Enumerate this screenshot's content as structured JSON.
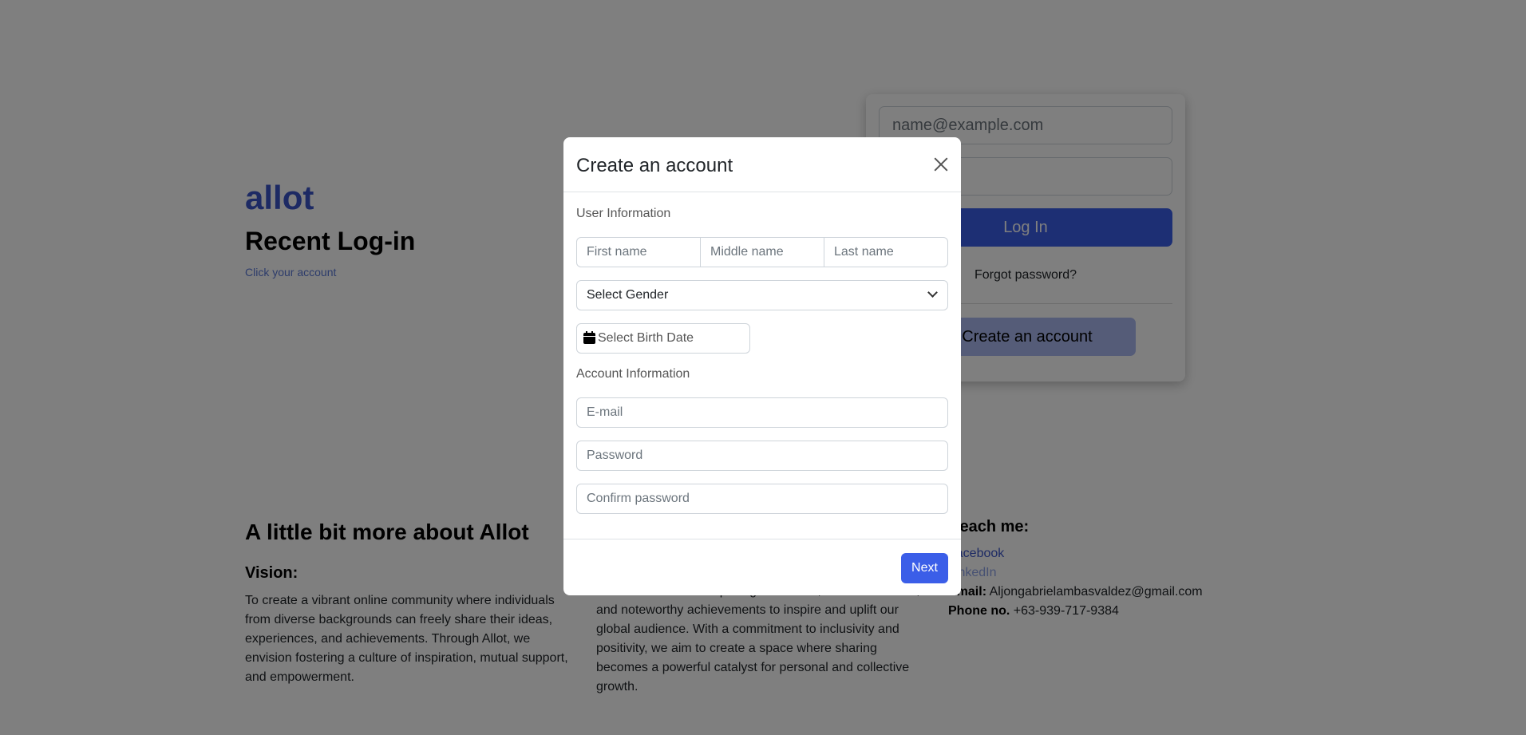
{
  "background": {
    "brand": "allot",
    "recent_login": {
      "title": "Recent Log-in",
      "subtitle": "Click your account"
    },
    "login_form": {
      "email_placeholder": "name@example.com",
      "login_label": "Log In",
      "forgot_label": "Forgot password?",
      "create_label": "Create an account"
    },
    "about": {
      "title": "A little bit more about Allot",
      "vision_title": "Vision:",
      "vision_text": "To create a vibrant online community where individuals from diverse backgrounds can freely share their ideas, experiences, and achievements. Through Allot, we envision fostering a culture of inspiration, mutual support, and empowerment.",
      "mission_text": "curate and share compelling life stories, innovative ideas, and noteworthy achievements to inspire and uplift our global audience. With a commitment to inclusivity and positivity, we aim to create a space where sharing becomes a powerful catalyst for personal and collective growth."
    },
    "contact": {
      "title": "Reach me:",
      "facebook": "Facebook",
      "linkedin": "LinkedIn",
      "email_label": "Email:",
      "email_value": "Aljongabrielambasvaldez@gmail.com",
      "phone_label": "Phone no.",
      "phone_value": "+63-939-717-9384"
    }
  },
  "modal": {
    "title": "Create an account",
    "user_section": "User Information",
    "first_name": "First name",
    "middle_name": "Middle name",
    "last_name": "Last name",
    "gender_select": "Select Gender",
    "birth_date": "Select Birth Date",
    "account_section": "Account Information",
    "email": "E-mail",
    "password": "Password",
    "confirm_password": "Confirm password",
    "next_label": "Next"
  },
  "colors": {
    "accent": "#3b5ee8",
    "brand": "#3a55c8",
    "overlay": "rgba(0,0,0,0.5)"
  }
}
